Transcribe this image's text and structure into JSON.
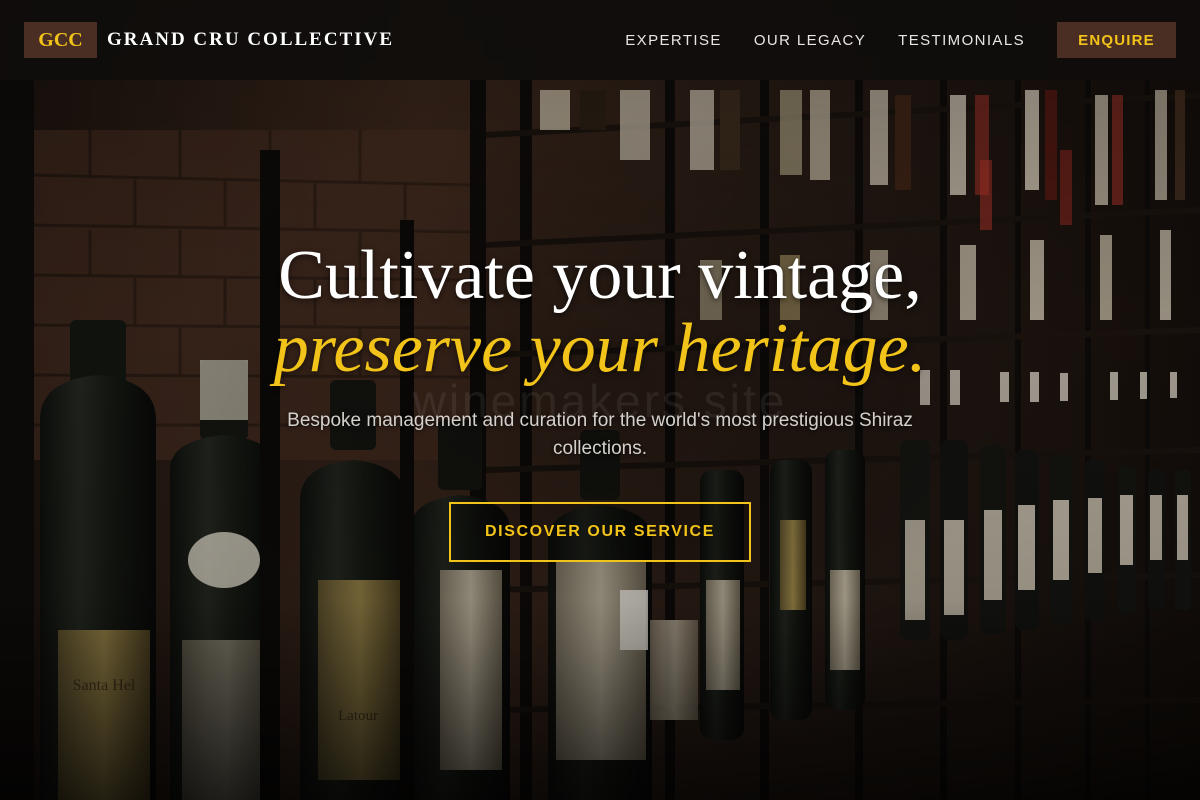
{
  "nav": {
    "brand_mark": "GCC",
    "brand_name": "GRAND CRU COLLECTIVE",
    "links": [
      "EXPERTISE",
      "OUR LEGACY",
      "TESTIMONIALS"
    ],
    "cta_label": "ENQUIRE"
  },
  "hero": {
    "headline_line1": "Cultivate your vintage,",
    "headline_line2": "preserve your heritage.",
    "watermark": "winemakers site",
    "subtitle": "Bespoke management and curation for the world's most prestigious Shiraz collections.",
    "cta_label": "DISCOVER OUR SERVICE"
  },
  "colors": {
    "accent": "#f2c318",
    "brand_dark": "#4a2e23",
    "nav_bg": "#0f0d0c"
  }
}
